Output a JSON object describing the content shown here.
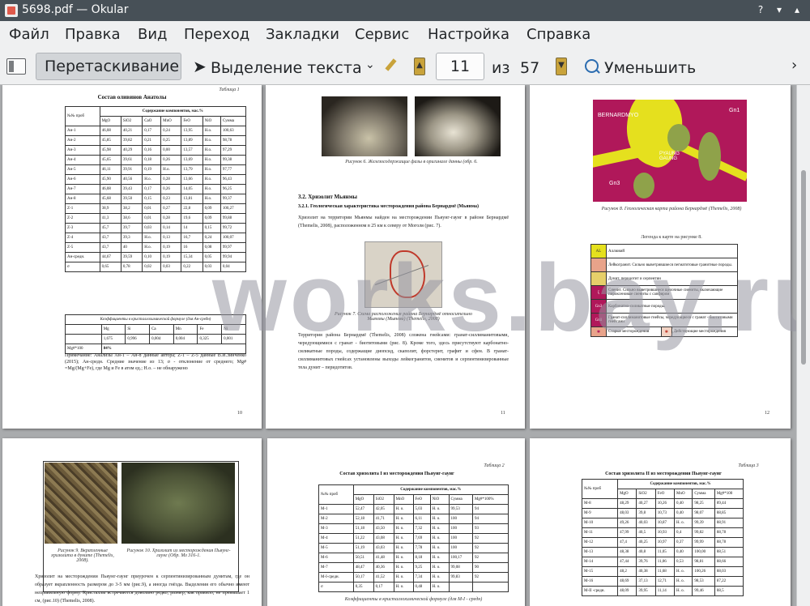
{
  "window": {
    "title": "5698.pdf — Okular"
  },
  "menu": [
    "Файл",
    "Правка",
    "Вид",
    "Переход",
    "Закладки",
    "Сервис",
    "Настройка",
    "Справка"
  ],
  "toolbar": {
    "drag_label": "Перетаскивание",
    "select_label": "Выделение текста",
    "page_value": "11",
    "of_label": "из",
    "total_pages": "57",
    "zoom_out_label": "Уменьшить"
  },
  "watermark": "works.bay.ru",
  "page10": {
    "table_label": "Таблица 1",
    "title": "Состав оливинов Анатолы",
    "header_group": "Содержание компонентов, мас.%",
    "columns": [
      "№№ проб",
      "MgO",
      "SiO2",
      "CaO",
      "MnO",
      "FeO",
      "NiO",
      "Сумма"
    ],
    "rows": [
      [
        "Ан-1",
        "46,08",
        "40,21",
        "0,17",
        "0,24",
        "13,95",
        "Н.о.",
        "100,63"
      ],
      [
        "Ан-2",
        "45,85",
        "39,82",
        "0,21",
        "0,25",
        "13,89",
        "Н.о.",
        "98,78"
      ],
      [
        "Ан-3",
        "45,98",
        "40,29",
        "0,16",
        "0,00",
        "13,57",
        "Н.о.",
        "97,29"
      ],
      [
        "Ан-4",
        "45,65",
        "39,61",
        "0,18",
        "0,26",
        "13,69",
        "Н.о.",
        "99,38"
      ],
      [
        "Ан-5",
        "46,11",
        "39,91",
        "0,19",
        "Н.о.",
        "13,79",
        "Н.о.",
        "97,77"
      ],
      [
        "Ан-6",
        "45,90",
        "40,56",
        "Н.о.",
        "0,28",
        "13,66",
        "Н.о.",
        "96,43"
      ],
      [
        "Ан-7",
        "46,08",
        "39,43",
        "0,17",
        "0,26",
        "14,05",
        "Н.о.",
        "96,25"
      ],
      [
        "Ан-8",
        "45,68",
        "39,50",
        "0,15",
        "0,23",
        "13,81",
        "Н.о.",
        "99,37"
      ],
      [
        "Z-1",
        "38,9",
        "38,2",
        "0,01",
        "0,27",
        "22,8",
        "0,09",
        "100,27"
      ],
      [
        "Z-2",
        "41,3",
        "38,6",
        "0,01",
        "0,28",
        "19,6",
        "0,09",
        "99,88"
      ],
      [
        "Z-3",
        "45,7",
        "39,7",
        "0,03",
        "0,14",
        "14",
        "0,15",
        "99,72"
      ],
      [
        "Z-4",
        "43,7",
        "39,3",
        "Н.о.",
        "0,13",
        "16,7",
        "0,24",
        "100,07"
      ],
      [
        "Z-5",
        "43,7",
        "40",
        "Н.о.",
        "0,19",
        "16",
        "0,08",
        "99,97"
      ],
      [
        "Ан-средн.",
        "44,67",
        "39,59",
        "0,10",
        "0,19",
        "15,34",
        "0,05",
        "99,94"
      ],
      [
        "σ",
        "0,65",
        "0,78",
        "0,02",
        "0,03",
        "0,22",
        "0,03",
        "0,04"
      ]
    ],
    "formula_caption": "Коэффициенты в кристаллохимической формуле (для Ан-средн)",
    "formula_columns": [
      "Mg",
      "Si",
      "Ca",
      "Mn",
      "Fe",
      "Ni"
    ],
    "formula_values": [
      "1,675",
      "0,996",
      "0,004",
      "0,004",
      "0,325",
      "0,001"
    ],
    "mg_label": "Mg#*100",
    "mg_value": "84%",
    "note": "Примечание: Анализы Ан-1 – Ан-8 данные автора; Z-1 – Z-5 данные В.И.Зинченко (2015); Ан-средн. Средние значение из 13; σ - отклонение от среднего; Mg# =Mg/(Mg+Fe), где Mg и Fe в атом ед.; Н.о. – не обнаружено",
    "number": "10"
  },
  "page11": {
    "fig6_caption": "Рисунок 6. Железосодержащие фазы в оригинале данны (обр. 6.",
    "section_heading": "3.2. Хризолит Мьянмы",
    "subsection_heading": "3.2.1. Геологическая характеристика месторождения района Бернардмё (Мьянма)",
    "para1": "Хризолит на территории Мьянмы найден на месторождении Пьяунг-гаунг в районе Бернардмё (Themelis, 2008), расположенном в 25 км к северу от Моголя (рис. 7).",
    "fig7_caption": "Рисунок 7. Схема расположения района Бернардмё относительно Мьянмы (Мьянма) (Themelis, 2008)",
    "para2": "Территория района Бернардмё (Themelis, 2008) сложена гнейсами: гранат-силлиманитовыми, чередующимися с гранат - биотитовыми (рис. 8). Кроме того, здесь присутствуют карбонатно-силикатные породы, содержащие диопсид, скаполит, форстерит, графит и сфен. В гранат-силлиманитовых гнейсах установлены выходы лейкогранитов, сиенитов и серпентинизированные тела дунит – перидотитов.",
    "number": "11"
  },
  "page12": {
    "fig8_caption": "Рисунок 8. Геологическая карта района Бернардмё (Themelis, 2008)",
    "legend_title": "Легенда к карте на рисунке 8.",
    "legend": [
      {
        "code": "AL",
        "text": "Аллювий"
      },
      {
        "code": "",
        "text": "Лейкогранит. Сильно выветрившиеся пегматитовые гранитные породы."
      },
      {
        "code": "",
        "text": "Дунит, перидотит и серпентин"
      },
      {
        "code": "ξ",
        "text": "Сиенит. Сильно выветрившиеся щелочные сиениты, включающие пироксеновые сиениты с сапфиром"
      },
      {
        "code": "Gn3",
        "text": "Карбонатно-силикатные породы."
      },
      {
        "code": "Gn1",
        "text": "Гранат-силлиманитовые гнейсы, чередующиеся с гранат - биотитовыми гнейсами"
      }
    ],
    "legend_old": "Старые месторождения",
    "legend_active": "Действующие месторождения",
    "map_labels": [
      "BERNARDMYO",
      "PYAUNG GAUNG",
      "Gn1",
      "Gn3"
    ],
    "number": "12"
  },
  "page13": {
    "fig9_caption": "Рисунок 9. Вкрапленные хризолита в дуните (Themelis, 2008).",
    "fig10_caption": "Рисунок 10. Хризолит из месторождения Пьяунг-гаунг (Обр. Мз 316-1.",
    "para": "Хризолит на месторождении Пьяунг-гаунг приурочен к серпентинизированным дунитам, где он образует вкрапленность размером до 3-5 мм (рис.9), а иногда гнёзда. Выделения его обычно имеют неправильную форму. Кристаллы встречаются довольно редко, размер, как правило, не превышает 1 см, (рис.10) (Themelis, 2008)."
  },
  "page14": {
    "table_label": "Таблица 2",
    "title": "Состав хризолита I из месторождения Пьяунг-гаунг",
    "header_group": "Содержание компонентов, мас.%",
    "columns": [
      "№№ проб",
      "MgO",
      "SiO2",
      "MnO",
      "FeO",
      "NiO",
      "Сумма",
      "Mg#*100%"
    ],
    "rows": [
      [
        "М-1",
        "52,47",
        "42,05",
        "Н. о.",
        "5,03",
        "Н. о.",
        "99,53",
        "94"
      ],
      [
        "М-2",
        "52,18",
        "41,71",
        "Н. о.",
        "6,11",
        "Н. о.",
        "100",
        "94"
      ],
      [
        "М-3",
        "51,18",
        "43,50",
        "Н. о.",
        "7,32",
        "Н. о.",
        "100",
        "93"
      ],
      [
        "М-4",
        "51,22",
        "43,08",
        "Н. о.",
        "7,69",
        "Н. о.",
        "100",
        "92"
      ],
      [
        "М-5",
        "51,19",
        "43,03",
        "Н. о.",
        "7,78",
        "Н. о.",
        "100",
        "92"
      ],
      [
        "М-6",
        "50,51",
        "41,48",
        "Н. о.",
        "8,18",
        "Н. о.",
        "100,17",
        "92"
      ],
      [
        "М-7",
        "48,47",
        "40,36",
        "Н. о.",
        "9,25",
        "Н. о.",
        "99,08",
        "90"
      ],
      [
        "М-І-средн.",
        "50,17",
        "41,52",
        "Н. о.",
        "7,34",
        "Н. о.",
        "99,83",
        "92"
      ],
      [
        "σ",
        "0,35",
        "0,17",
        "Н. о.",
        "0,48",
        "Н. о.",
        "",
        ""
      ]
    ],
    "formula_caption": "Коэффициенты в кристаллохимической формуле (для М-І - средн)"
  },
  "page15": {
    "table_label": "Таблица 3",
    "title": "Состав хризолита II из месторождения Пьяунг-гаунг",
    "header_group": "Содержание компонентов, мас.%",
    "columns": [
      "№№ проб",
      "MgO",
      "SiO2",
      "FeO",
      "MnO",
      "Сумма",
      "Mg#*100"
    ],
    "rows": [
      [
        "М-8",
        "48,29",
        "40,27",
        "10,26",
        "0,40",
        "98,25",
        "89,44"
      ],
      [
        "М-9",
        "48,03",
        "39,8",
        "10,73",
        "0,40",
        "98,07",
        "88,85"
      ],
      [
        "М-10",
        "49,26",
        "40,03",
        "10,87",
        "Н. о.",
        "99,39",
        "88,91"
      ],
      [
        "М-11",
        "47,99",
        "40,5",
        "10,93",
        "0,4",
        "99,82",
        "88,78"
      ],
      [
        "М-12",
        "47,4",
        "40,25",
        "10,97",
        "0,37",
        "99,99",
        "88,78"
      ],
      [
        "М-13",
        "48,38",
        "40,8",
        "11,05",
        "0,40",
        "100,00",
        "88,51"
      ],
      [
        "М-14",
        "47,44",
        "39,76",
        "11,06",
        "0,53",
        "98,81",
        "88,66"
      ],
      [
        "М-15",
        "48,2",
        "40,38",
        "11,68",
        "Н. о.",
        "100,26",
        "88,03"
      ],
      [
        "М-16",
        "48,69",
        "37,13",
        "12,71",
        "Н. о.",
        "98,53",
        "87,22"
      ],
      [
        "М-II -средн.",
        "48,09",
        "39,95",
        "11,14",
        "Н. о.",
        "99,46",
        "88,5"
      ]
    ]
  },
  "colors": {
    "map_magenta": "#b0185a",
    "map_yellow": "#e5e01e",
    "titlebar": "#475057",
    "viewport": "#a9abad"
  }
}
